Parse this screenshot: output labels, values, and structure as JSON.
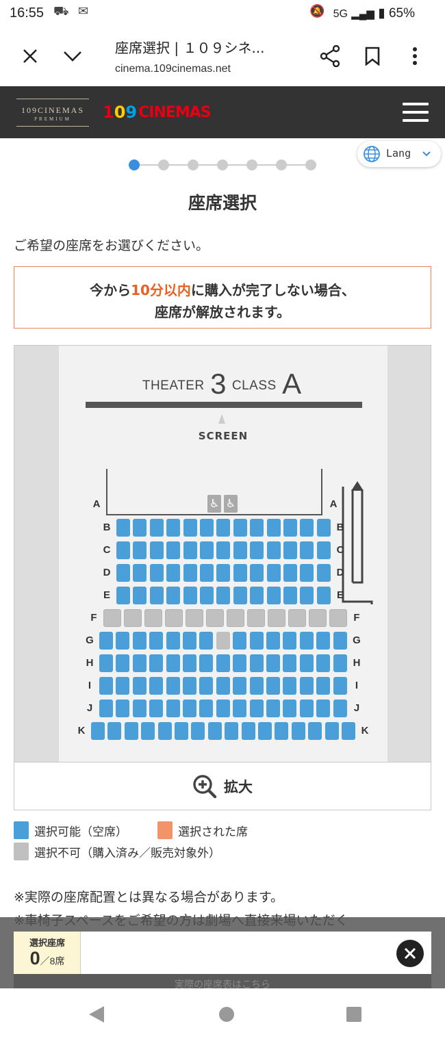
{
  "status": {
    "time": "16:55",
    "network": "5G",
    "battery": "65%"
  },
  "browser": {
    "title": "座席選択 | １０９シネ...",
    "url": "cinema.109cinemas.net"
  },
  "header": {
    "premium_brand": "109CINEMAS",
    "premium_sub": "PREMIUM",
    "logo_numbers": [
      "1",
      "0",
      "9"
    ],
    "logo_word": "CINEMAS"
  },
  "lang": {
    "label": "Lang"
  },
  "steps": {
    "total": 7,
    "active": 0
  },
  "page": {
    "title": "座席選択",
    "instruction": "ご希望の座席をお選びください。"
  },
  "notice": {
    "prefix": "今から",
    "emphasis": "10分以内",
    "suffix": "に購入が完了しない場合、",
    "line2": "座席が解放されます。"
  },
  "theater": {
    "prefix": "THEATER",
    "number": "3",
    "class_prefix": "CLASS",
    "class": "A",
    "screen_label": "SCREEN"
  },
  "rows": [
    {
      "label": "A",
      "count": 2,
      "type": "wheelchair"
    },
    {
      "label": "B",
      "count": 13,
      "type": "available"
    },
    {
      "label": "C",
      "count": 13,
      "type": "available"
    },
    {
      "label": "D",
      "count": 13,
      "type": "available"
    },
    {
      "label": "E",
      "count": 13,
      "type": "available"
    },
    {
      "label": "F",
      "count": 12,
      "type": "unavailable"
    },
    {
      "label": "G",
      "count": 15,
      "type": "available",
      "unavailable_index": 7
    },
    {
      "label": "H",
      "count": 15,
      "type": "available"
    },
    {
      "label": "I",
      "count": 15,
      "type": "available"
    },
    {
      "label": "J",
      "count": 15,
      "type": "available"
    },
    {
      "label": "K",
      "count": 16,
      "type": "available"
    }
  ],
  "zoom": {
    "label": "拡大"
  },
  "legend": {
    "available": "選択可能（空席）",
    "selected": "選択された席",
    "unavailable": "選択不可（購入済み／販売対象外）"
  },
  "colors": {
    "available": "#4a9fd8",
    "selected": "#f2936a",
    "unavailable": "#c0c0c0",
    "accent": "#3a8ee0",
    "notice_border": "#e8835a",
    "notice_emphasis": "#e8611f"
  },
  "notes": {
    "line1": "※実際の座席配置とは異なる場合があります。",
    "line2": "※車椅子スペースをご希望の方は劇場へ直接来場いただく"
  },
  "selection": {
    "label": "選択座席",
    "count": "0",
    "max": "／8席"
  },
  "hidden_button": {
    "label": "実際の座席表はこちら"
  }
}
